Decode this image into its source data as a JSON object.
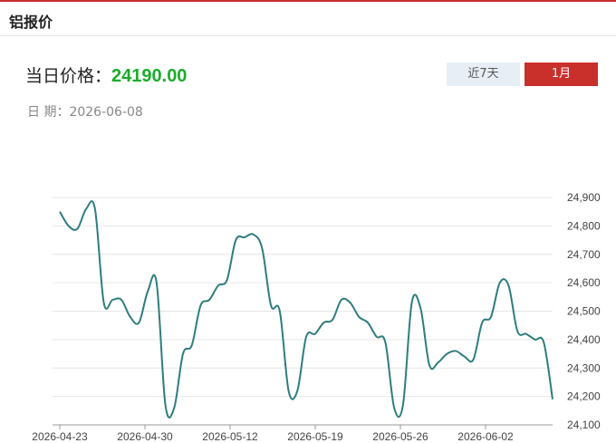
{
  "header": {
    "title": "铝报价"
  },
  "price": {
    "label": "当日价格：",
    "value": "24190.00"
  },
  "date": {
    "label": "日 期：",
    "value": "2026-06-08"
  },
  "range_buttons": {
    "week": "近7天",
    "month": "1月",
    "active": "month"
  },
  "colors": {
    "accent": "#c9302c",
    "price": "#1aad2b",
    "line": "#2e7d7d",
    "inactive_button": "#e8eef6"
  },
  "chart_data": {
    "type": "line",
    "x": [
      "2026-04-23",
      "2026-04-24",
      "2026-04-25",
      "2026-04-26",
      "2026-04-27",
      "2026-04-28",
      "2026-04-29",
      "2026-04-30",
      "2026-05-01",
      "2026-05-02",
      "2026-05-03",
      "2026-05-04",
      "2026-05-05",
      "2026-05-06",
      "2026-05-07",
      "2026-05-08",
      "2026-05-09",
      "2026-05-10",
      "2026-05-11",
      "2026-05-12",
      "2026-05-13",
      "2026-05-14",
      "2026-05-15",
      "2026-05-16",
      "2026-05-17",
      "2026-05-18",
      "2026-05-19",
      "2026-05-20",
      "2026-05-21",
      "2026-05-22",
      "2026-05-23",
      "2026-05-24",
      "2026-05-25",
      "2026-05-26",
      "2026-05-27",
      "2026-05-28",
      "2026-05-29",
      "2026-05-30",
      "2026-05-31",
      "2026-06-01",
      "2026-06-02",
      "2026-06-03",
      "2026-06-04",
      "2026-06-05",
      "2026-06-06",
      "2026-06-07",
      "2026-06-08"
    ],
    "series": [
      {
        "values": [
          24850,
          24800,
          24790,
          24860,
          24860,
          24530,
          24540,
          24540,
          24480,
          24460,
          24570,
          24600,
          24170,
          24160,
          24350,
          24380,
          24520,
          24540,
          24590,
          24610,
          24750,
          24760,
          24770,
          24720,
          24520,
          24500,
          24220,
          24220,
          24410,
          24420,
          24460,
          24470,
          24540,
          24530,
          24480,
          24460,
          24410,
          24390,
          24160,
          24170,
          24530,
          24510,
          24310,
          24320,
          24350,
          24360,
          24340,
          24330,
          24460,
          24480,
          24600,
          24590,
          24430,
          24420,
          24400,
          24390,
          24190
        ]
      }
    ],
    "x_ticks": [
      "2026-04-23",
      "2026-04-30",
      "2026-05-12",
      "2026-05-19",
      "2026-05-26",
      "2026-06-02"
    ],
    "y_ticks": [
      "24,100",
      "24,200",
      "24,300",
      "24,400",
      "24,500",
      "24,600",
      "24,700",
      "24,800",
      "24,900"
    ],
    "ylim": [
      24100,
      24900
    ],
    "grid": true,
    "y_axis_side": "right"
  }
}
